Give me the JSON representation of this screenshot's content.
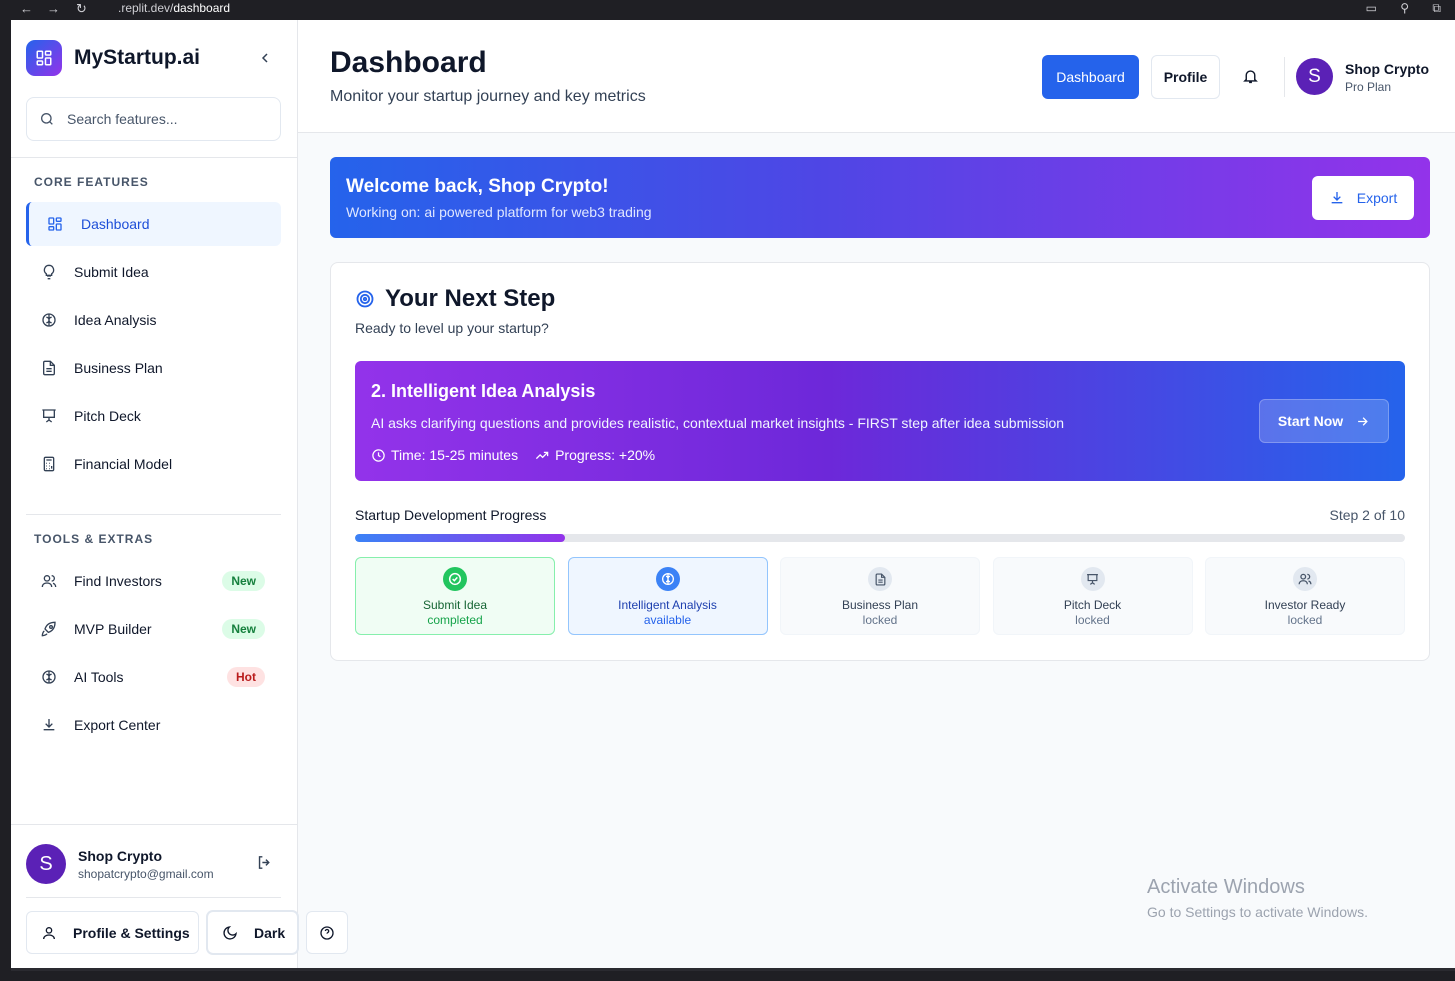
{
  "browser": {
    "url_prefix": ".replit.dev/",
    "url_path": "dashboard"
  },
  "sidebar": {
    "brand": "MyStartup.ai",
    "search_placeholder": "Search features...",
    "core_title": "CORE FEATURES",
    "core_items": [
      {
        "label": "Dashboard",
        "icon": "grid-icon",
        "active": true
      },
      {
        "label": "Submit Idea",
        "icon": "lightbulb-icon"
      },
      {
        "label": "Idea Analysis",
        "icon": "brain-icon"
      },
      {
        "label": "Business Plan",
        "icon": "document-icon"
      },
      {
        "label": "Pitch Deck",
        "icon": "presentation-icon"
      },
      {
        "label": "Financial Model",
        "icon": "calculator-icon"
      }
    ],
    "tools_title": "TOOLS & EXTRAS",
    "tools_items": [
      {
        "label": "Find Investors",
        "icon": "users-icon",
        "badge": "New"
      },
      {
        "label": "MVP Builder",
        "icon": "rocket-icon",
        "badge": "New"
      },
      {
        "label": "AI Tools",
        "icon": "brain-icon",
        "badge": "Hot"
      },
      {
        "label": "Export Center",
        "icon": "download-icon"
      }
    ],
    "user": {
      "initial": "S",
      "name": "Shop Crypto",
      "email": "shopatcrypto@gmail.com"
    },
    "profile_settings_label": "Profile & Settings",
    "dark_label": "Dark"
  },
  "header": {
    "title": "Dashboard",
    "subtitle": "Monitor your startup journey and key metrics",
    "dashboard_button": "Dashboard",
    "profile_button": "Profile",
    "user_initial": "S",
    "user_name": "Shop Crypto",
    "user_plan": "Pro Plan"
  },
  "welcome": {
    "title": "Welcome back, Shop Crypto!",
    "subtitle": "Working on: ai powered platform for web3 trading",
    "export_label": "Export"
  },
  "next_step": {
    "title": "Your Next Step",
    "subtitle": "Ready to level up your startup?",
    "step_title": "2. Intelligent Idea Analysis",
    "step_description": "AI asks clarifying questions and provides realistic, contextual market insights - FIRST step after idea submission",
    "time": "Time: 15-25 minutes",
    "progress_gain": "Progress: +20%",
    "start_label": "Start Now"
  },
  "progress": {
    "label": "Startup Development Progress",
    "step_text": "Step 2 of 10",
    "fraction": 0.2,
    "stages": [
      {
        "name": "Submit Idea",
        "status": "completed",
        "icon": "check-circle-icon"
      },
      {
        "name": "Intelligent Analysis",
        "status": "available",
        "icon": "brain-icon"
      },
      {
        "name": "Business Plan",
        "status": "locked",
        "icon": "document-icon"
      },
      {
        "name": "Pitch Deck",
        "status": "locked",
        "icon": "presentation-icon"
      },
      {
        "name": "Investor Ready",
        "status": "locked",
        "icon": "users-icon"
      }
    ]
  },
  "watermark": {
    "line1": "Activate Windows",
    "line2": "Go to Settings to activate Windows."
  },
  "colors": {
    "primary": "#2563eb",
    "purple": "#9333ea",
    "avatar": "#5b21b6",
    "success": "#22c55e"
  }
}
